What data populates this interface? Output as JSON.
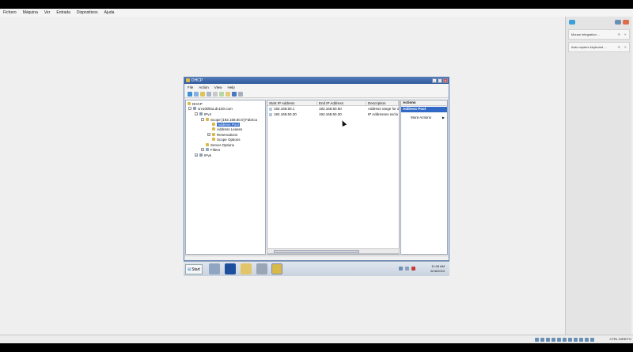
{
  "vm_menu": [
    "Fichero",
    "Máquina",
    "Ver",
    "Entrada",
    "Dispositivos",
    "Ajuda"
  ],
  "notifications": [
    {
      "label": "Mouse integration ..."
    },
    {
      "label": "Auto capture keyboard ..."
    }
  ],
  "host_key": "CTRL DIREITO",
  "window": {
    "title": "DHCP",
    "menu": [
      "File",
      "Action",
      "View",
      "Help"
    ]
  },
  "tree": {
    "root": "DHCP",
    "server": "srv100lina.dc100.com",
    "ipv4": "IPv4",
    "scope": "Scope [192.168.50.0] Fabrica",
    "address_pool": "Address Pool",
    "address_leases": "Address Leases",
    "reservations": "Reservations",
    "scope_options": "Scope Options",
    "server_options": "Server Options",
    "filters": "Filters",
    "ipv6": "IPv6"
  },
  "list": {
    "columns": [
      "Start IP Address",
      "End IP Address",
      "Description"
    ],
    "rows": [
      {
        "start": "192.168.50.1",
        "end": "192.168.50.50",
        "desc": "Address range for d"
      },
      {
        "start": "192.168.50.30",
        "end": "192.168.50.30",
        "desc": "IP Addresses exclu"
      }
    ]
  },
  "actions": {
    "header": "Actions",
    "selected": "Address Pool",
    "more": "More Actions"
  },
  "taskbar": {
    "start": "Start",
    "time": "11:08 AM",
    "date": "6/18/2024"
  },
  "colors": {
    "selection": "#3169c6",
    "titlebar": "#2f5a9c"
  }
}
